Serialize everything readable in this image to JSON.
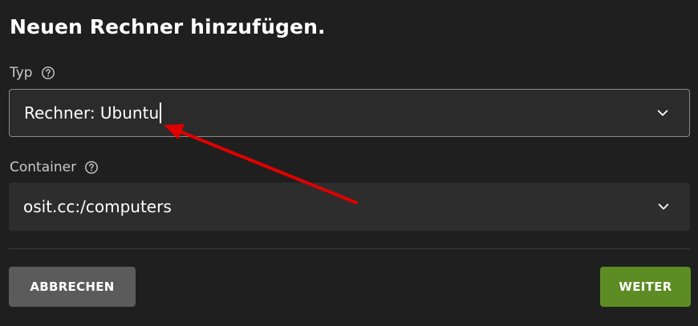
{
  "dialog": {
    "title": "Neuen Rechner hinzufügen."
  },
  "fields": {
    "type": {
      "label": "Typ",
      "value": "Rechner: Ubuntu",
      "help_icon": "question-circle-icon",
      "dropdown_icon": "chevron-down-icon"
    },
    "container": {
      "label": "Container",
      "value": "osit.cc:/computers",
      "help_icon": "question-circle-icon",
      "dropdown_icon": "chevron-down-icon"
    }
  },
  "actions": {
    "cancel_label": "ABBRECHEN",
    "next_label": "WEITER"
  },
  "annotation": {
    "arrow_color": "#e00000",
    "arrow_icon": "red-arrow-annotation"
  },
  "colors": {
    "background": "#1f1f1f",
    "field_background": "#2d2d2d",
    "cancel_button": "#5b5b5b",
    "next_button": "#5d8b24"
  }
}
